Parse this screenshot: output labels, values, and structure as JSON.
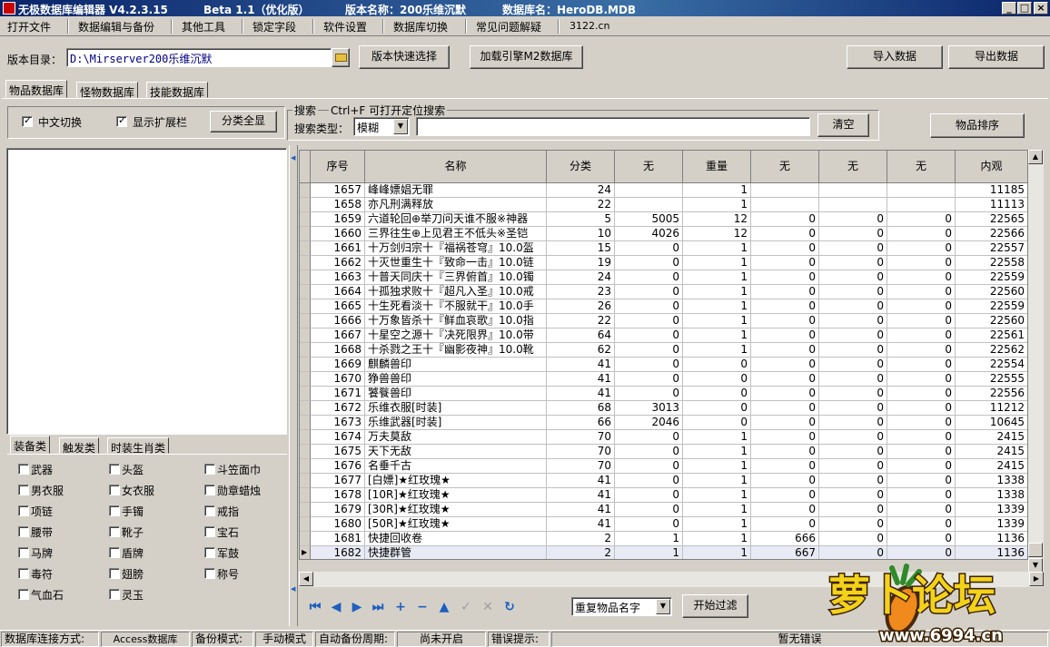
{
  "window": {
    "app_title": "无极数据库编辑器 V4.2.3.15",
    "beta": "Beta 1.1（优化版）",
    "version_name": "版本名称：200乐维沉默",
    "db_name": "数据库名：HeroDB.MDB",
    "min": "_",
    "max": "□",
    "close": "×"
  },
  "menu": {
    "items": [
      "打开文件",
      "数据编辑与备份",
      "其他工具",
      "锁定字段",
      "软件设置",
      "数据库切换",
      "常见问题解疑",
      "3122.cn"
    ]
  },
  "toolbar": {
    "dir_label": "版本目录：",
    "dir_value": "D:\\Mirserver200乐维沉默",
    "quick_select": "版本快速选择",
    "load_engine": "加载引擎M2数据库",
    "import": "导入数据",
    "export": "导出数据"
  },
  "tabs": [
    "物品数据库",
    "怪物数据库",
    "技能数据库"
  ],
  "options": {
    "chinese_toggle": "中文切换",
    "show_ext": "显示扩展栏",
    "show_all": "分类全显"
  },
  "search": {
    "title": "搜索",
    "hint": "Ctrl+F 可打开定位搜索",
    "type_label": "搜索类型：",
    "type_value": "模糊",
    "value": "",
    "clear": "清空",
    "sort": "物品排序"
  },
  "category_tabs": [
    "装备类",
    "触发类",
    "时装生肖类"
  ],
  "categories": [
    "武器",
    "头盔",
    "斗笠面巾",
    "男衣服",
    "女衣服",
    "勋章蜡烛",
    "项链",
    "手镯",
    "戒指",
    "腰带",
    "靴子",
    "宝石",
    "马牌",
    "盾牌",
    "军鼓",
    "毒符",
    "翅膀",
    "称号",
    "气血石",
    "灵玉"
  ],
  "grid": {
    "columns": [
      "序号",
      "名称",
      "分类",
      "无",
      "重量",
      "无",
      "无",
      "无",
      "内观"
    ],
    "rows": [
      [
        "1657",
        "峰峰嫖娼无罪",
        "24",
        "",
        "1",
        "",
        "",
        "",
        "11185"
      ],
      [
        "1658",
        "亦凡刑满释放",
        "22",
        "",
        "1",
        "",
        "",
        "",
        "11113"
      ],
      [
        "1659",
        "六道轮回⊕举刀问天谁不服※神器",
        "5",
        "5005",
        "12",
        "0",
        "0",
        "0",
        "22565"
      ],
      [
        "1660",
        "三界往生⊕上见君王不低头※圣铠",
        "10",
        "4026",
        "12",
        "0",
        "0",
        "0",
        "22566"
      ],
      [
        "1661",
        "十万剑归宗十『福祸苍穹』10.0盔",
        "15",
        "0",
        "1",
        "0",
        "0",
        "0",
        "22557"
      ],
      [
        "1662",
        "十灭世重生十『致命一击』10.0链",
        "19",
        "0",
        "1",
        "0",
        "0",
        "0",
        "22558"
      ],
      [
        "1663",
        "十普天同庆十『三界俯首』10.0镯",
        "24",
        "0",
        "1",
        "0",
        "0",
        "0",
        "22559"
      ],
      [
        "1664",
        "十孤独求败十『超凡入圣』10.0戒",
        "23",
        "0",
        "1",
        "0",
        "0",
        "0",
        "22560"
      ],
      [
        "1665",
        "十生死看淡十『不服就干』10.0手",
        "26",
        "0",
        "1",
        "0",
        "0",
        "0",
        "22559"
      ],
      [
        "1666",
        "十万象皆杀十『鲜血哀歌』10.0指",
        "22",
        "0",
        "1",
        "0",
        "0",
        "0",
        "22560"
      ],
      [
        "1667",
        "十星空之源十『决死限界』10.0带",
        "64",
        "0",
        "1",
        "0",
        "0",
        "0",
        "22561"
      ],
      [
        "1668",
        "十杀戮之王十『幽影夜神』10.0靴",
        "62",
        "0",
        "1",
        "0",
        "0",
        "0",
        "22562"
      ],
      [
        "1669",
        "麒麟兽印",
        "41",
        "0",
        "0",
        "0",
        "0",
        "0",
        "22554"
      ],
      [
        "1670",
        "狰兽兽印",
        "41",
        "0",
        "0",
        "0",
        "0",
        "0",
        "22555"
      ],
      [
        "1671",
        "饕餮兽印",
        "41",
        "0",
        "0",
        "0",
        "0",
        "0",
        "22556"
      ],
      [
        "1672",
        "乐维衣服[时装]",
        "68",
        "3013",
        "0",
        "0",
        "0",
        "0",
        "11212"
      ],
      [
        "1673",
        "乐维武器[时装]",
        "66",
        "2046",
        "0",
        "0",
        "0",
        "0",
        "10645"
      ],
      [
        "1674",
        "万夫莫敌",
        "70",
        "0",
        "1",
        "0",
        "0",
        "0",
        "2415"
      ],
      [
        "1675",
        "天下无敌",
        "70",
        "0",
        "1",
        "0",
        "0",
        "0",
        "2415"
      ],
      [
        "1676",
        "名垂千古",
        "70",
        "0",
        "1",
        "0",
        "0",
        "0",
        "2415"
      ],
      [
        "1677",
        "[白嫖]★红玫瑰★",
        "41",
        "0",
        "1",
        "0",
        "0",
        "0",
        "1338"
      ],
      [
        "1678",
        "[10R]★红玫瑰★",
        "41",
        "0",
        "1",
        "0",
        "0",
        "0",
        "1338"
      ],
      [
        "1679",
        "[30R]★红玫瑰★",
        "41",
        "0",
        "1",
        "0",
        "0",
        "0",
        "1339"
      ],
      [
        "1680",
        "[50R]★红玫瑰★",
        "41",
        "0",
        "1",
        "0",
        "0",
        "0",
        "1339"
      ],
      [
        "1681",
        "快捷回收卷",
        "2",
        "1",
        "1",
        "666",
        "0",
        "0",
        "1136"
      ],
      [
        "1682",
        "快捷群管",
        "2",
        "1",
        "1",
        "667",
        "0",
        "0",
        "1136"
      ]
    ]
  },
  "filter": {
    "dup_value": "重复物品名字",
    "start": "开始过滤"
  },
  "statusbar": {
    "conn_label": "数据库连接方式:",
    "conn_value": "Access数据库",
    "backup_label": "备份模式:",
    "backup_value": "手动模式",
    "auto_label": "自动备份周期:",
    "auto_value": "尚未开启",
    "err_label": "错误提示:",
    "err_value": "暂无错误"
  },
  "watermark": {
    "text": "萝卜论坛",
    "url": "www.6994.cn"
  }
}
